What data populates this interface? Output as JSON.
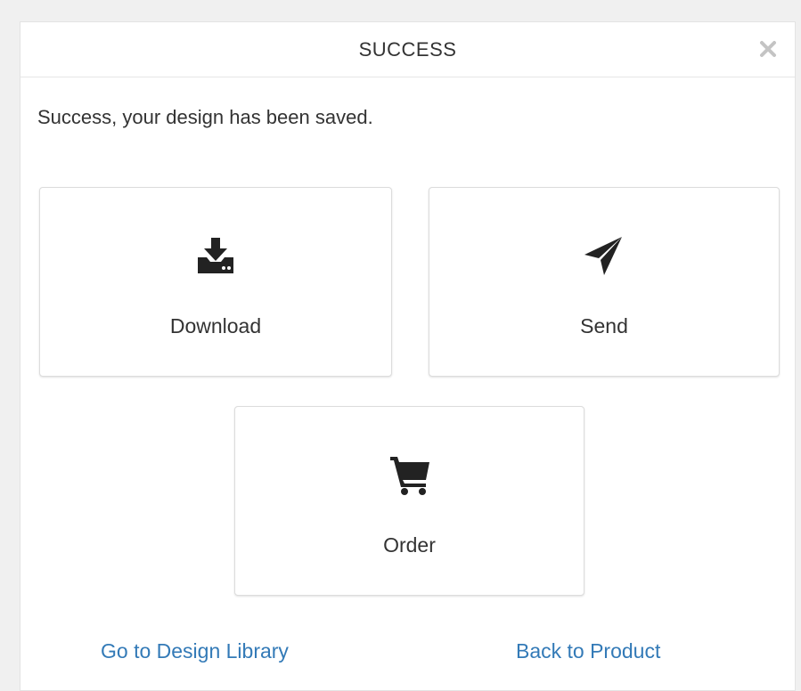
{
  "dialog": {
    "title": "SUCCESS",
    "close_icon": "close-icon",
    "message": "Success, your design has been saved."
  },
  "actions": [
    {
      "label": "Download",
      "icon": "download-icon"
    },
    {
      "label": "Send",
      "icon": "paper-plane-icon"
    },
    {
      "label": "Order",
      "icon": "shopping-cart-icon"
    }
  ],
  "links": {
    "library": "Go to Design Library",
    "product": "Back to Product"
  },
  "colors": {
    "link": "#337ab7",
    "icon": "#222222",
    "text": "#333333"
  }
}
